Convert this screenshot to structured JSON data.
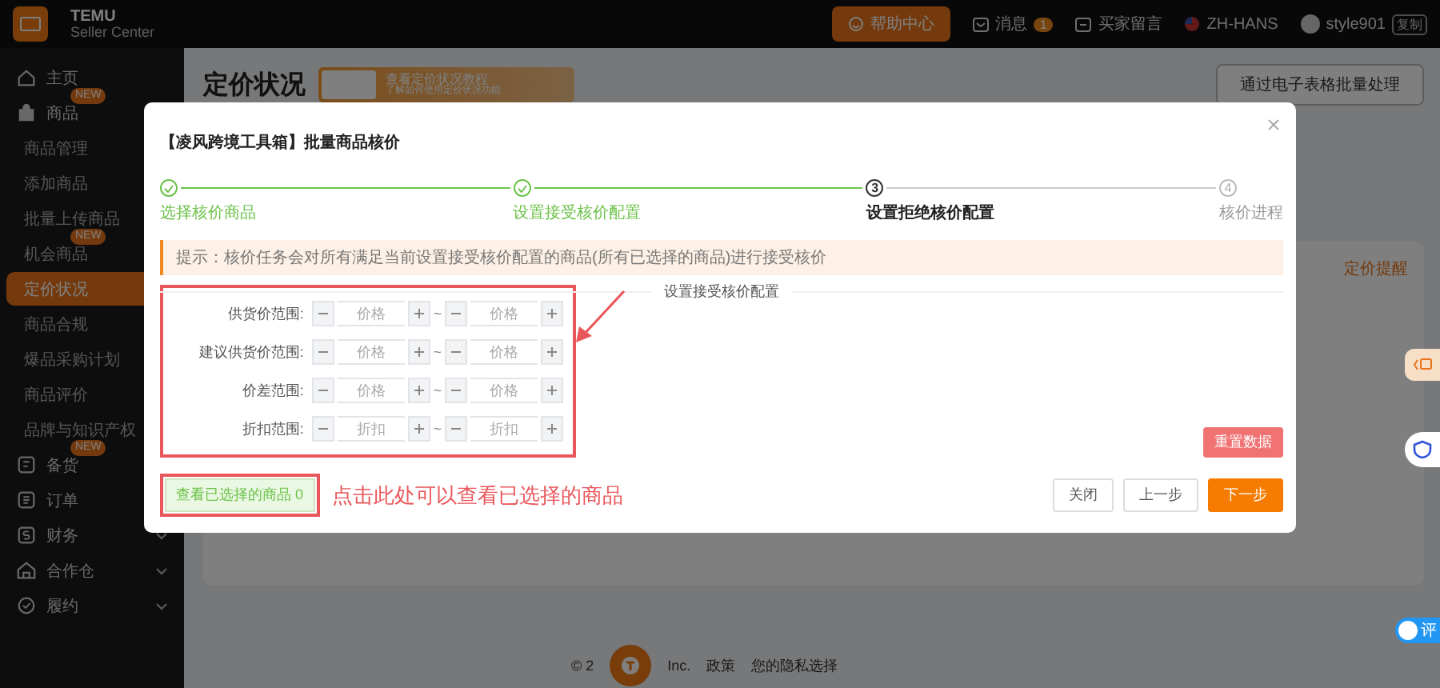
{
  "topbar": {
    "brand": "TEMU",
    "subtitle": "Seller Center",
    "help": "帮助中心",
    "messages": {
      "label": "消息",
      "badge": "1"
    },
    "buyer_messages": "买家留言",
    "language": "ZH-HANS",
    "user": {
      "name": "style901",
      "tag": "复制"
    }
  },
  "sidebar": {
    "items": [
      {
        "label": "主页",
        "selected": false
      },
      {
        "label": "商品",
        "badge": "NEW",
        "selected": false,
        "children": [
          {
            "label": "商品管理",
            "selected": false
          },
          {
            "label": "添加商品",
            "selected": false
          },
          {
            "label": "批量上传商品",
            "selected": false
          },
          {
            "label": "机会商品",
            "badge": "NEW",
            "selected": false
          },
          {
            "label": "定价状况",
            "selected": true
          },
          {
            "label": "商品合规",
            "selected": false
          },
          {
            "label": "爆品采购计划",
            "selected": false
          },
          {
            "label": "商品评价",
            "selected": false
          },
          {
            "label": "品牌与知识产权",
            "selected": false
          }
        ]
      },
      {
        "label": "备货",
        "badge": "NEW",
        "selected": false
      },
      {
        "label": "订单",
        "selected": false
      },
      {
        "label": "财务",
        "selected": false,
        "expanded": false
      },
      {
        "label": "合作仓",
        "selected": false,
        "expanded": false
      },
      {
        "label": "履约",
        "selected": false,
        "expanded": false
      }
    ]
  },
  "page": {
    "title": "定价状况",
    "banner": {
      "title": "查看定价状况教程",
      "subtitle": "了解如何使用定价状况功能"
    },
    "bulk_button": "通过电子表格批量处理",
    "side_link": "定价提醒"
  },
  "modal": {
    "title": "【凌风跨境工具箱】批量商品核价",
    "steps": [
      {
        "label": "选择核价商品",
        "completed": true,
        "active": false
      },
      {
        "label": "设置接受核价配置",
        "completed": true,
        "active": false
      },
      {
        "label": "设置拒绝核价配置",
        "completed": false,
        "active": true,
        "number": "3"
      },
      {
        "label": "核价进程",
        "completed": false,
        "active": false,
        "number": "4"
      }
    ],
    "alert": "提示：核价任务会对所有满足当前设置接受核价配置的商品(所有已选择的商品)进行接受核价",
    "section_title": "设置接受核价配置",
    "ranges": [
      {
        "label": "供货价范围:",
        "min_placeholder": "价格",
        "separator": "~",
        "max_placeholder": "价格"
      },
      {
        "label": "建议供货价范围:",
        "min_placeholder": "价格",
        "separator": "~",
        "max_placeholder": "价格"
      },
      {
        "label": "价差范围:",
        "min_placeholder": "价格",
        "separator": "~",
        "max_placeholder": "价格"
      },
      {
        "label": "折扣范围:",
        "min_placeholder": "折扣",
        "separator": "~",
        "max_placeholder": "折扣"
      }
    ],
    "reset_button": "重置数据",
    "selected_button": "查看已选择的商品 0",
    "annotation": "点击此处可以查看已选择的商品",
    "buttons": [
      {
        "label": "关闭",
        "kind": "default"
      },
      {
        "label": "上一步",
        "kind": "default"
      },
      {
        "label": "下一步",
        "kind": "primary"
      }
    ]
  },
  "footer": {
    "copyright_start": "© 2",
    "copyright_end": "Inc.",
    "links": [
      "政策",
      "您的隐私选择"
    ]
  },
  "review_toggle": "评"
}
